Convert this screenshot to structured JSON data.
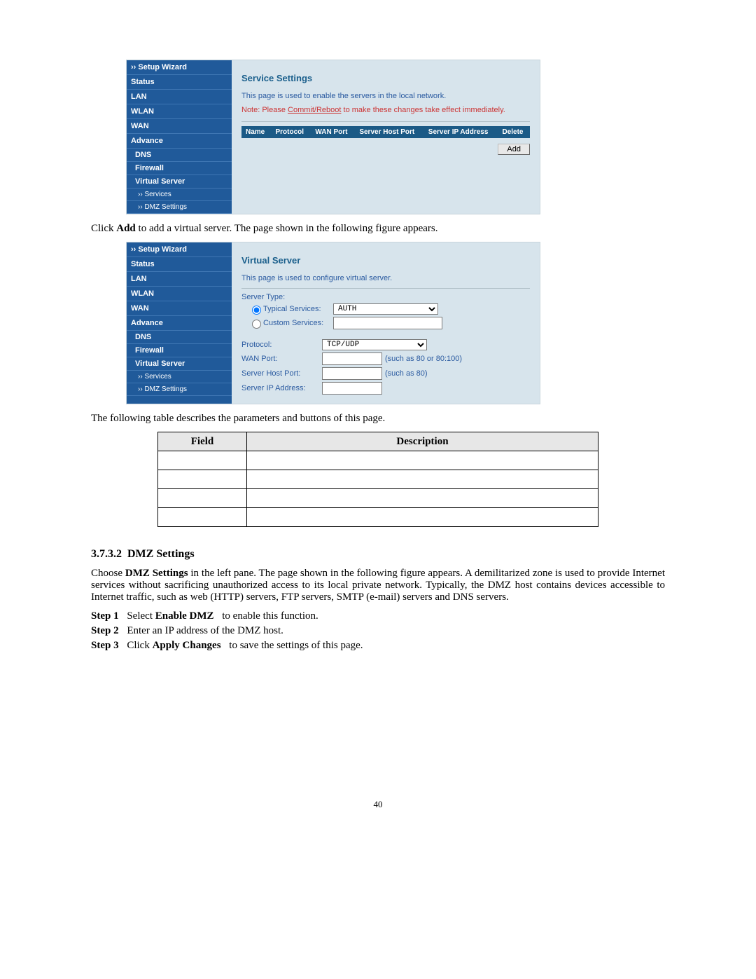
{
  "screenshot1": {
    "sidebar": {
      "setup_wizard": "›› Setup Wizard",
      "status": "Status",
      "lan": "LAN",
      "wlan": "WLAN",
      "wan": "WAN",
      "advance": "Advance",
      "dns": "DNS",
      "firewall": "Firewall",
      "virtual_server": "Virtual Server",
      "services": "›› Services",
      "dmz": "›› DMZ Settings"
    },
    "content": {
      "heading": "Service Settings",
      "desc": "This page is used to enable the servers in the local network.",
      "note_prefix": "Note: Please ",
      "note_link": "Commit/Reboot",
      "note_suffix": " to make these changes take effect immediately.",
      "th_name": "Name",
      "th_protocol": "Protocol",
      "th_wan_port": "WAN Port",
      "th_server_host_port": "Server Host Port",
      "th_server_ip": "Server IP Address",
      "th_delete": "Delete",
      "add_button": "Add"
    }
  },
  "text_after_ss1_a": "Click ",
  "text_after_ss1_b": "Add",
  "text_after_ss1_c": " to add a virtual server. The page shown in the following figure appears.",
  "screenshot2": {
    "sidebar": {
      "setup_wizard": "›› Setup Wizard",
      "status": "Status",
      "lan": "LAN",
      "wlan": "WLAN",
      "wan": "WAN",
      "advance": "Advance",
      "dns": "DNS",
      "firewall": "Firewall",
      "virtual_server": "Virtual Server",
      "services": "›› Services",
      "dmz": "›› DMZ Settings"
    },
    "content": {
      "heading": "Virtual Server",
      "desc": "This page is used to configure virtual server.",
      "server_type": "Server Type:",
      "typical_services": "Typical Services:",
      "typical_value": "AUTH",
      "custom_services": "Custom Services:",
      "protocol": "Protocol:",
      "protocol_value": "TCP/UDP",
      "wan_port": "WAN Port:",
      "wan_hint": "(such as 80 or 80:100)",
      "server_host_port": "Server Host Port:",
      "host_hint": "(such as 80)",
      "server_ip": "Server IP Address:"
    }
  },
  "text_after_ss2": "The following table describes the parameters and buttons of this page.",
  "param_table": {
    "h_field": "Field",
    "h_desc": "Description"
  },
  "subheading_num": "3.7.3.2",
  "subheading_title": "DMZ Settings",
  "dmz_para_a": "Choose ",
  "dmz_para_b": "DMZ Settings",
  "dmz_para_c": " in the left pane. The page shown in the following figure appears. A demilitarized zone is used to provide Internet services without sacrificing unauthorized access to its local private network. Typically, the DMZ host contains devices accessible to Internet traffic, such as web (HTTP) servers, FTP servers, SMTP (e-mail) servers and DNS servers.",
  "step1_label": "Step 1",
  "step1_a": "Select ",
  "step1_b": "Enable DMZ",
  "step1_c": " to enable this function.",
  "step2_label": "Step 2",
  "step2_text": "Enter an IP address of the DMZ host.",
  "step3_label": "Step 3",
  "step3_a": "Click ",
  "step3_b": "Apply Changes",
  "step3_c": " to save the settings of this page.",
  "page_number": "40"
}
